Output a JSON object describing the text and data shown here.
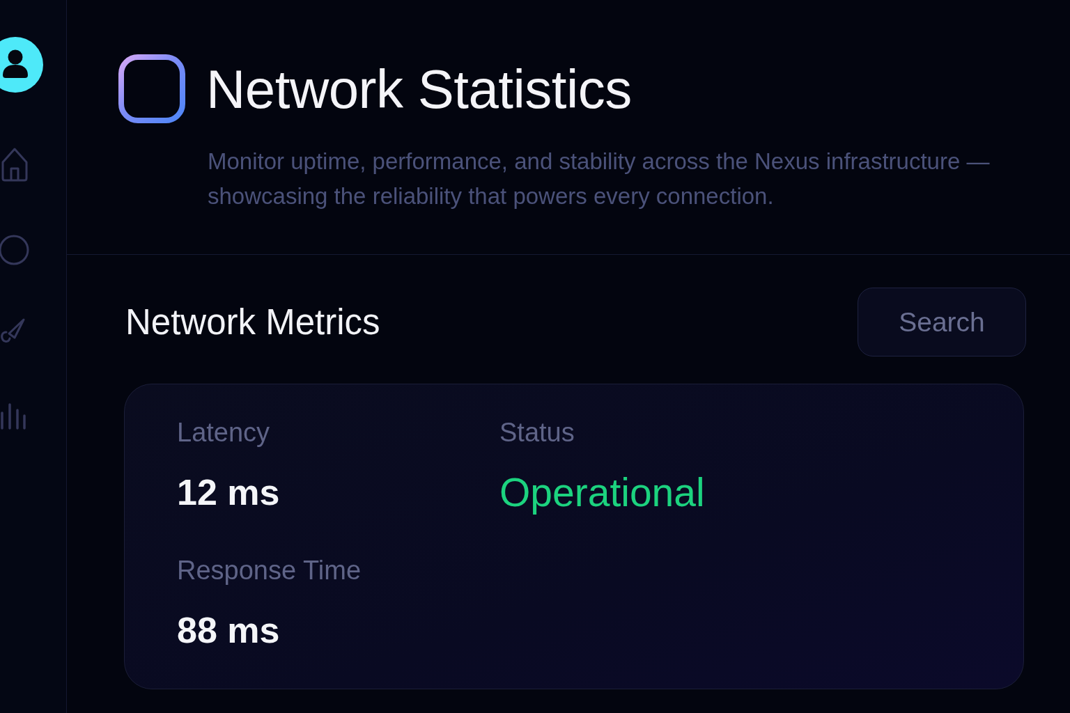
{
  "header": {
    "title": "Network Statistics",
    "subtitle": "Monitor uptime, performance, and stability across the Nexus infrastructure — showcasing the reliability that powers every connection."
  },
  "section": {
    "title": "Network Metrics",
    "search_button": "Search"
  },
  "metrics": [
    {
      "kind": "number",
      "label": "Latency",
      "value": "12 ms"
    },
    {
      "kind": "status",
      "label": "Status",
      "value": "Operational"
    },
    {
      "kind": "number",
      "label": "Response Time",
      "value": "88 ms"
    }
  ]
}
